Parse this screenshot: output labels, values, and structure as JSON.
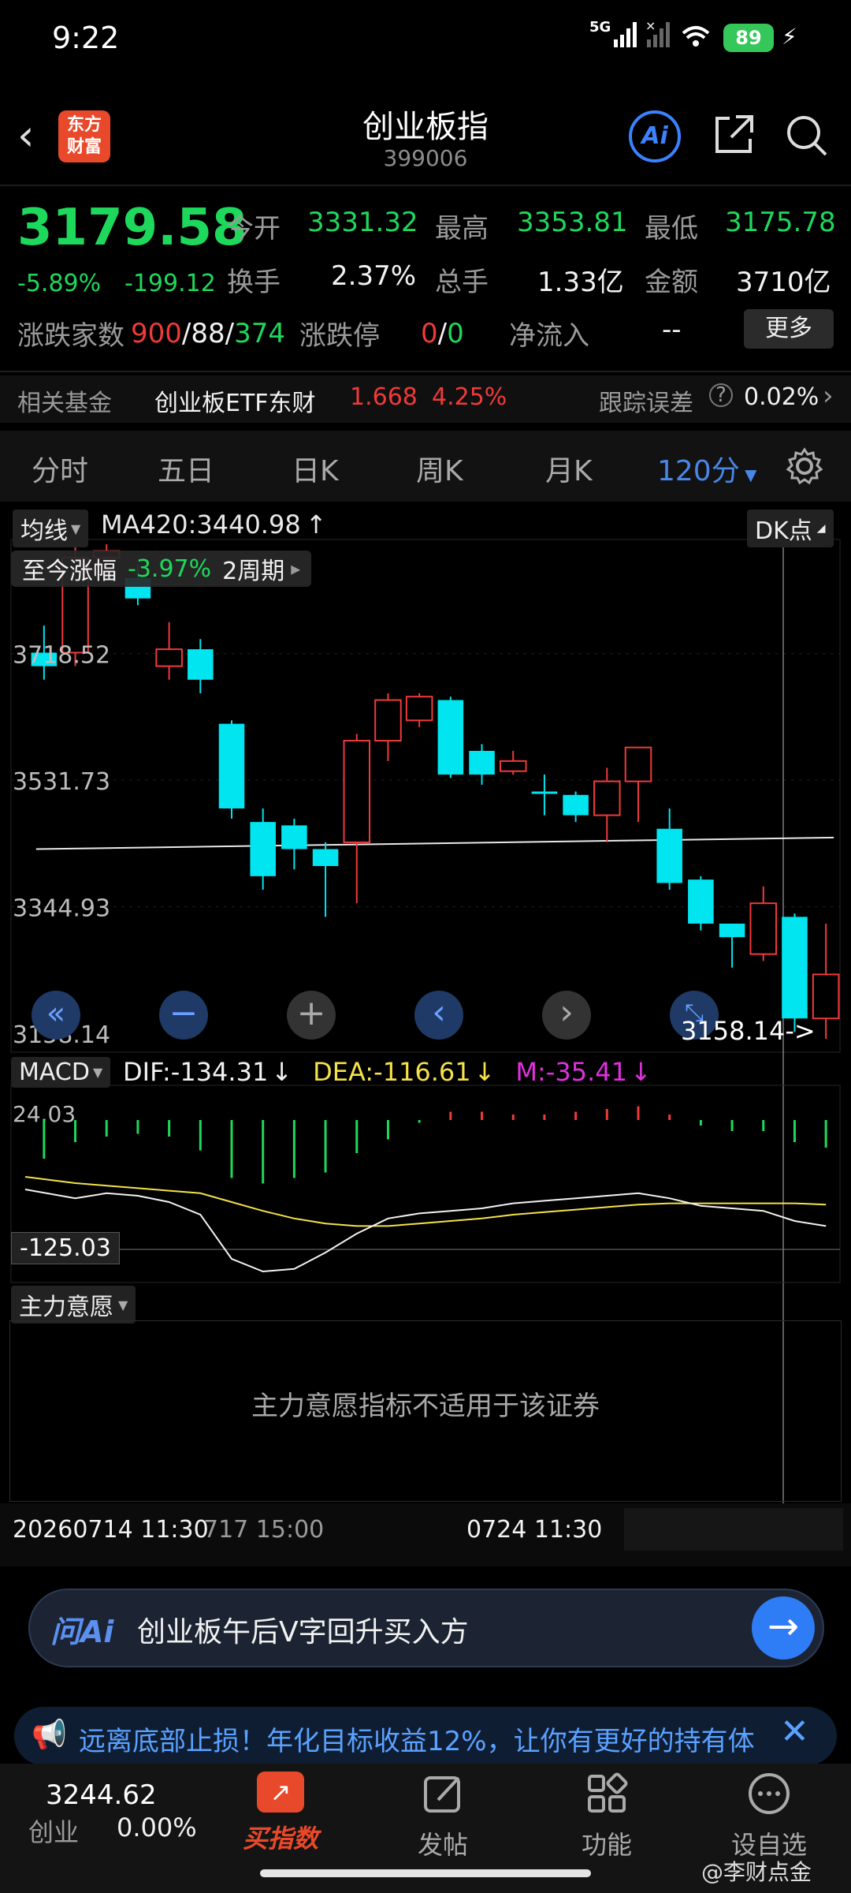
{
  "status_bar": {
    "time": "9:22",
    "network": "5G",
    "battery": "89"
  },
  "header": {
    "title": "创业板指",
    "code": "399006",
    "logo_text": "东方财富",
    "ai_label": "Ai"
  },
  "quote": {
    "price": "3179.58",
    "change_pct": "-5.89%",
    "change_val": "-199.12",
    "open_label": "今开",
    "open": "3331.32",
    "high_label": "最高",
    "high": "3353.81",
    "low_label": "最低",
    "low": "3175.78",
    "turnover_label": "换手",
    "turnover": "2.37%",
    "volume_label": "总手",
    "volume": "1.33亿",
    "amount_label": "金额",
    "amount": "3710亿",
    "breadth_label": "涨跌家数",
    "breadth_up": "900",
    "breadth_flat": "88",
    "breadth_down": "374",
    "limit_label": "涨跌停",
    "limit_up": "0",
    "limit_down": "0",
    "netflow_label": "净流入",
    "netflow": "--",
    "more": "更多"
  },
  "fund_row": {
    "label": "相关基金",
    "name": "创业板ETF东财",
    "price": "1.668",
    "pct": "4.25%",
    "te_label": "跟踪误差",
    "te_value": "0.02%"
  },
  "tabs": [
    "分时",
    "五日",
    "日K",
    "周K",
    "月K",
    "120分"
  ],
  "tabs_active_index": 5,
  "chart_header": {
    "ma_chip": "均线",
    "ma_text": "MA420:3440.98",
    "ma_arrow": "↑",
    "dk_chip": "DK点",
    "period_label": "至今涨幅",
    "period_pct": "-3.97%",
    "period_span": "2周期"
  },
  "macd_header": {
    "chip": "MACD",
    "dif": "DIF:-134.31",
    "dea": "DEA:-116.61",
    "m": "M:-35.41",
    "arrow": "↓"
  },
  "zhuli": {
    "chip": "主力意愿",
    "message": "主力意愿指标不适用于该证券"
  },
  "time_axis": {
    "left": "20260714 11:30",
    "left_partial": "717 15:00",
    "mid": "0724 11:30"
  },
  "ai_bar": {
    "brand": "问Ai",
    "query": "创业板午后V字回升买入方"
  },
  "news": {
    "text": "远离底部止损！年化目标收益12%，让你有更好的持有体"
  },
  "bottom_nav": {
    "index_value": "3244.62",
    "index_name": "创业",
    "index_pct": "0.00%",
    "items": [
      "买指数",
      "发帖",
      "功能",
      "设自选"
    ]
  },
  "watermark": "@李财点金",
  "colors": {
    "up": "#f03a3a",
    "down": "#00e5f0",
    "accent": "#4a86e8",
    "green": "#1ed85c"
  },
  "chart_data": {
    "type": "candlestick",
    "price_axis_labels": [
      "3718.52",
      "3531.73",
      "3344.93",
      "3158.14"
    ],
    "ylim": [
      3158.14,
      3880
    ],
    "last_marker": "3158.14->",
    "candles": [
      {
        "o": 3700,
        "c": 3720,
        "h": 3760,
        "l": 3680,
        "d": "down"
      },
      {
        "o": 3720,
        "c": 3860,
        "h": 3880,
        "l": 3700,
        "d": "up"
      },
      {
        "o": 3860,
        "c": 3870,
        "h": 3880,
        "l": 3830,
        "d": "up"
      },
      {
        "o": 3830,
        "c": 3800,
        "h": 3850,
        "l": 3790,
        "d": "down"
      },
      {
        "o": 3700,
        "c": 3725,
        "h": 3765,
        "l": 3680,
        "d": "up"
      },
      {
        "o": 3725,
        "c": 3680,
        "h": 3740,
        "l": 3660,
        "d": "down"
      },
      {
        "o": 3615,
        "c": 3490,
        "h": 3620,
        "l": 3475,
        "d": "down"
      },
      {
        "o": 3470,
        "c": 3390,
        "h": 3490,
        "l": 3370,
        "d": "down"
      },
      {
        "o": 3465,
        "c": 3430,
        "h": 3475,
        "l": 3400,
        "d": "down"
      },
      {
        "o": 3430,
        "c": 3405,
        "h": 3440,
        "l": 3330,
        "d": "down"
      },
      {
        "o": 3440,
        "c": 3590,
        "h": 3600,
        "l": 3350,
        "d": "up"
      },
      {
        "o": 3590,
        "c": 3650,
        "h": 3660,
        "l": 3560,
        "d": "up"
      },
      {
        "o": 3620,
        "c": 3655,
        "h": 3660,
        "l": 3610,
        "d": "up"
      },
      {
        "o": 3650,
        "c": 3540,
        "h": 3655,
        "l": 3535,
        "d": "down"
      },
      {
        "o": 3575,
        "c": 3540,
        "h": 3585,
        "l": 3525,
        "d": "down"
      },
      {
        "o": 3545,
        "c": 3560,
        "h": 3575,
        "l": 3540,
        "d": "up"
      },
      {
        "o": 3515,
        "c": 3515,
        "h": 3540,
        "l": 3480,
        "d": "down"
      },
      {
        "o": 3510,
        "c": 3480,
        "h": 3515,
        "l": 3470,
        "d": "down"
      },
      {
        "o": 3480,
        "c": 3530,
        "h": 3550,
        "l": 3440,
        "d": "up"
      },
      {
        "o": 3530,
        "c": 3580,
        "h": 3580,
        "l": 3470,
        "d": "up"
      },
      {
        "o": 3460,
        "c": 3380,
        "h": 3490,
        "l": 3370,
        "d": "down"
      },
      {
        "o": 3385,
        "c": 3320,
        "h": 3390,
        "l": 3310,
        "d": "down"
      },
      {
        "o": 3320,
        "c": 3300,
        "h": 3320,
        "l": 3255,
        "d": "down"
      },
      {
        "o": 3275,
        "c": 3350,
        "h": 3375,
        "l": 3265,
        "d": "up"
      },
      {
        "o": 3330,
        "c": 3180,
        "h": 3335,
        "l": 3160,
        "d": "down"
      },
      {
        "o": 3180,
        "c": 3245,
        "h": 3320,
        "l": 3150,
        "d": "up"
      }
    ],
    "ma_line": [
      [
        0,
        3430
      ],
      [
        25,
        3447
      ]
    ],
    "macd_axis_labels": [
      "24.03",
      "-125.03"
    ],
    "macd_bars": [
      -70,
      -40,
      -30,
      -25,
      -30,
      -55,
      -105,
      -115,
      -105,
      -95,
      -60,
      -35,
      -5,
      15,
      15,
      10,
      10,
      15,
      20,
      25,
      10,
      -10,
      -20,
      -20,
      -40,
      -50
    ],
    "dif": [
      -105,
      -112,
      -108,
      -110,
      -115,
      -125,
      -160,
      -170,
      -168,
      -155,
      -140,
      -128,
      -124,
      -122,
      -120,
      -116,
      -114,
      -112,
      -110,
      -108,
      -112,
      -118,
      -120,
      -122,
      -130,
      -134
    ],
    "dea": [
      -95,
      -100,
      -102,
      -104,
      -106,
      -108,
      -115,
      -122,
      -128,
      -132,
      -134,
      -134,
      -132,
      -130,
      -128,
      -125,
      -123,
      -121,
      -119,
      -117,
      -116,
      -116,
      -116,
      -116,
      -116,
      -117
    ]
  }
}
